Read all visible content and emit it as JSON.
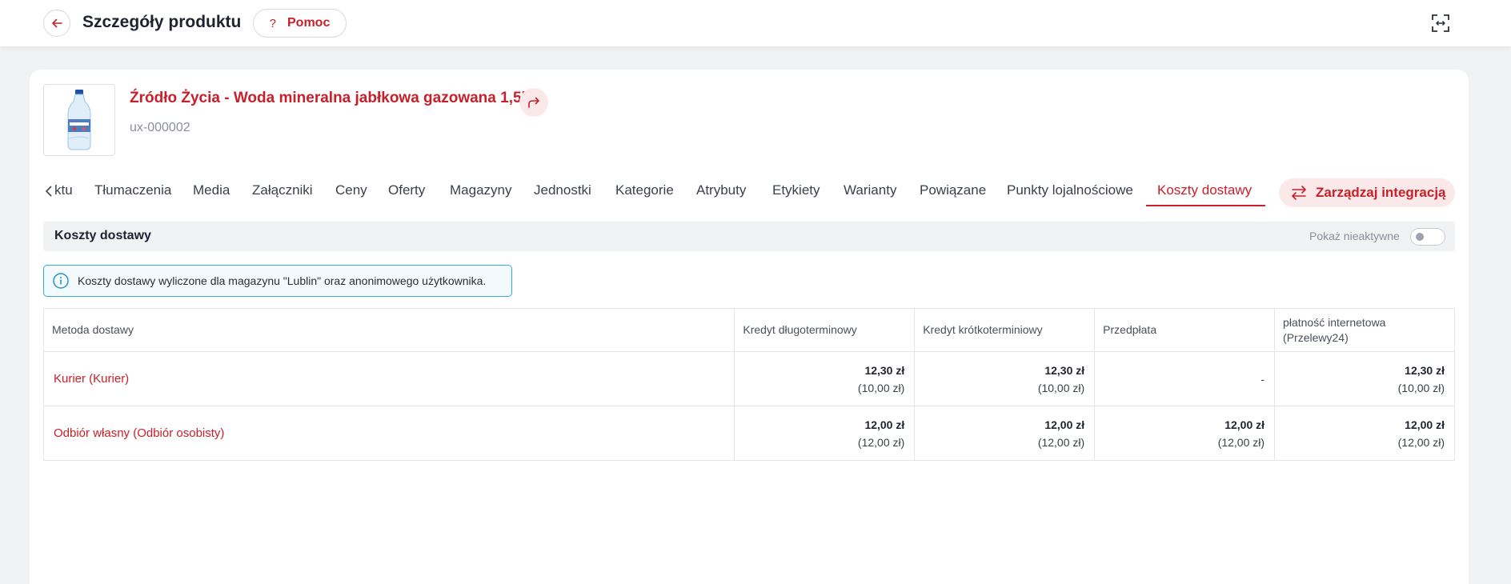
{
  "header": {
    "title": "Szczegóły produktu",
    "help_label": "Pomoc",
    "help_icon": "?"
  },
  "product": {
    "name": "Źródło Życia - Woda mineralna jabłkowa gazowana 1,5l",
    "sku": "ux-000002"
  },
  "tabs": {
    "partial": "ktu",
    "items": [
      {
        "label": "Tłumaczenia"
      },
      {
        "label": "Media"
      },
      {
        "label": "Załączniki"
      },
      {
        "label": "Ceny"
      },
      {
        "label": "Oferty"
      },
      {
        "label": "Magazyny"
      },
      {
        "label": "Jednostki"
      },
      {
        "label": "Kategorie"
      },
      {
        "label": "Atrybuty"
      },
      {
        "label": "Etykiety"
      },
      {
        "label": "Warianty"
      },
      {
        "label": "Powiązane"
      },
      {
        "label": "Punkty lojalnościowe"
      },
      {
        "label": "Koszty dostawy"
      }
    ],
    "active": "Koszty dostawy"
  },
  "integration_button": {
    "label": "Zarządzaj integracją"
  },
  "section": {
    "title": "Koszty dostawy",
    "show_inactive_label": "Pokaż nieaktywne",
    "show_inactive": false
  },
  "info": {
    "text": "Koszty dostawy wyliczone dla magazynu \"Lublin\" oraz anonimowego użytkownika."
  },
  "table": {
    "headers": [
      "Metoda dostawy",
      "Kredyt długoterminowy",
      "Kredyt krótkoterminiowy",
      "Przedpłata",
      "płatność internetowa (Przelewy24)"
    ],
    "rows": [
      {
        "method": "Kurier (Kurier)",
        "cells": [
          {
            "gross": "12,30 zł",
            "net": "(10,00 zł)"
          },
          {
            "gross": "12,30 zł",
            "net": "(10,00 zł)"
          },
          {
            "gross": "-",
            "net": ""
          },
          {
            "gross": "12,30 zł",
            "net": "(10,00 zł)"
          }
        ]
      },
      {
        "method": "Odbiór własny (Odbiór osobisty)",
        "cells": [
          {
            "gross": "12,00 zł",
            "net": "(12,00 zł)"
          },
          {
            "gross": "12,00 zł",
            "net": "(12,00 zł)"
          },
          {
            "gross": "12,00 zł",
            "net": "(12,00 zł)"
          },
          {
            "gross": "12,00 zł",
            "net": "(12,00 zł)"
          }
        ]
      }
    ]
  },
  "colors": {
    "accent": "#c8202a",
    "accent_soft": "#fbe9ea",
    "info_border": "#3aa8e0",
    "background": "#f1f2f4"
  },
  "icons": {
    "back": "arrow-left-icon",
    "help": "question-icon",
    "expand": "expand-icon",
    "share": "share-arrow-icon",
    "tabs_prev": "chevron-left-icon",
    "integration": "swap-arrows-icon",
    "info": "info-circle-icon"
  }
}
